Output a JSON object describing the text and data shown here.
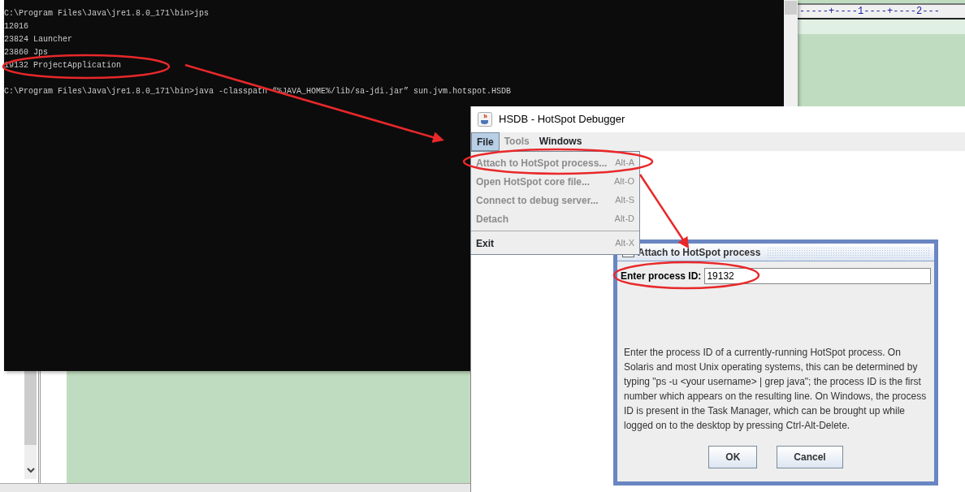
{
  "editor": {
    "ruler": "-----+----1----+----2---"
  },
  "console": {
    "blocks": [
      [
        "C:\\Program Files\\Java\\jre1.8.0_171\\bin>jps",
        "12016",
        "23824 Launcher",
        "23860 Jps",
        "19132 ProjectApplication"
      ],
      [
        "C:\\Program Files\\Java\\jre1.8.0_171\\bin>java -classpath “%JAVA_HOME%/lib/sa-jdi.jar” sun.jvm.hotspot.HSDB"
      ]
    ]
  },
  "hsdb": {
    "title": "HSDB - HotSpot Debugger",
    "menus": [
      {
        "label": "File",
        "selected": true,
        "disabled": false
      },
      {
        "label": "Tools",
        "selected": false,
        "disabled": true
      },
      {
        "label": "Windows",
        "selected": false,
        "disabled": false
      }
    ],
    "file_menu": [
      {
        "kind": "item",
        "label": "Attach to HotSpot process...",
        "shortcut": "Alt-A",
        "disabled": true
      },
      {
        "kind": "item",
        "label": "Open HotSpot core file...",
        "shortcut": "Alt-O",
        "disabled": true
      },
      {
        "kind": "item",
        "label": "Connect to debug server...",
        "shortcut": "Alt-S",
        "disabled": true
      },
      {
        "kind": "item",
        "label": "Detach",
        "shortcut": "Alt-D",
        "disabled": true
      },
      {
        "kind": "separator"
      },
      {
        "kind": "item",
        "label": "Exit",
        "shortcut": "Alt-X",
        "disabled": false
      }
    ]
  },
  "dialog": {
    "title": "Attach to HotSpot process",
    "field_label": "Enter process ID:",
    "value": "19132",
    "description": "Enter the process ID of a currently-running HotSpot process. On Solaris and most Unix operating systems, this can be determined by typing \"ps -u <your username> | grep java\"; the process ID is the first number which appears on the resulting line. On Windows, the process ID is present in the Task Manager, which can be brought up while logged on to the desktop by pressing Ctrl-Alt-Delete.",
    "buttons": [
      "OK",
      "Cancel"
    ]
  }
}
